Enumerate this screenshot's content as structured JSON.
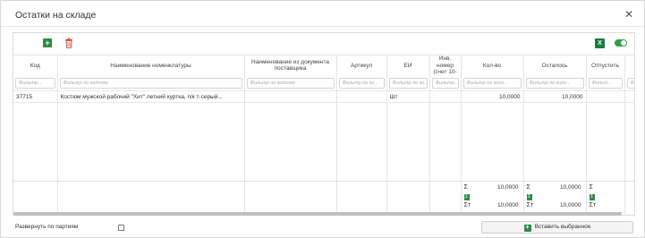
{
  "dialog": {
    "title": "Остатки на складе",
    "close_icon": "close-icon"
  },
  "toolbar": {
    "add_icon": "plus-icon",
    "delete_icon": "trash-icon",
    "excel_icon": "excel-icon",
    "excel_label": "X",
    "toggle_state": "on",
    "accent": "#2e8b45"
  },
  "table": {
    "columns": [
      {
        "key": "code",
        "label": "Код",
        "filter": "Фильтр..."
      },
      {
        "key": "name",
        "label": "Наименование номенклатуры",
        "filter": "Фильтр по колонке"
      },
      {
        "key": "supplier_name",
        "label": "Наименование из документа поставщика",
        "filter": "Фильтр по колонке"
      },
      {
        "key": "article",
        "label": "Артикул",
        "filter": "Фильтр по ко..."
      },
      {
        "key": "unit",
        "label": "ЕИ",
        "filter": "Фильтр по ко..."
      },
      {
        "key": "inv",
        "label": "Инв. номер (счет 10-",
        "filter": "Фильтр..."
      },
      {
        "key": "qty",
        "label": "Кол-во",
        "filter": "Фильтр по коло..."
      },
      {
        "key": "left",
        "label": "Осталось",
        "filter": "Фильтр по коло..."
      },
      {
        "key": "release",
        "label": "Отпустить",
        "filter": "Фильт..."
      },
      {
        "key": "extra",
        "label": "",
        "filter": "Ф..."
      }
    ],
    "rows": [
      {
        "code": "37715",
        "name": "Костюм мужской рабочий \"Хит\" летний куртка, п/к т-серый...",
        "supplier_name": "",
        "article": "",
        "unit": "Шт",
        "inv": "",
        "qty": "10,0000",
        "left": "10,0000",
        "release": ""
      }
    ],
    "footer": {
      "qty_sum": "10,0000",
      "qty_total": "10,0000",
      "left_sum": "10,0000",
      "left_total": "10,0000",
      "sigma": "Σ",
      "sigma_box": "Σ",
      "sigma_total": "Σт"
    }
  },
  "bottom": {
    "expand_label": "Развернуть по партиям",
    "expand_checked": false,
    "insert_label": "Вставить выбранное",
    "insert_icon": "plus-icon"
  }
}
